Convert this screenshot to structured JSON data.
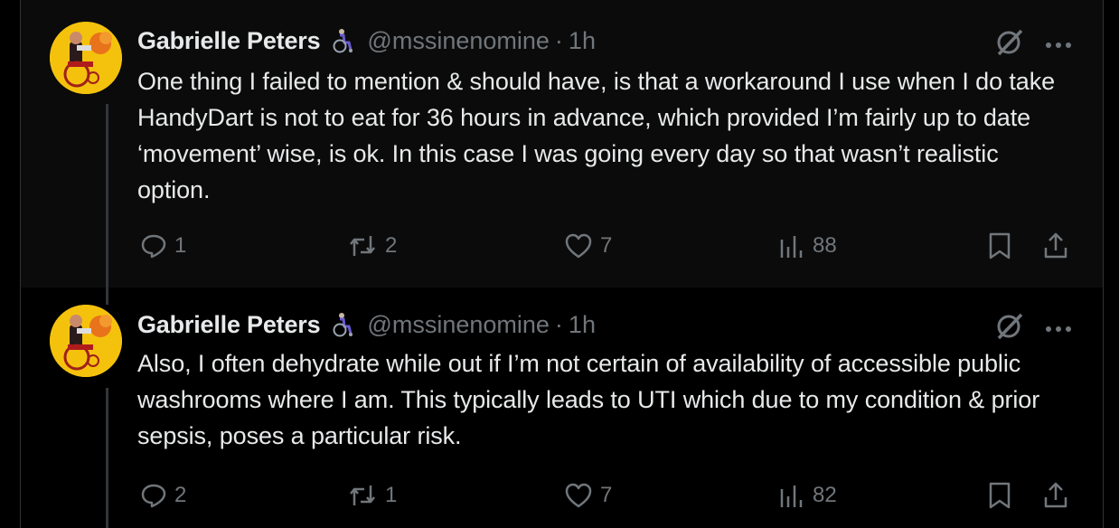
{
  "tweets": [
    {
      "author_name": "Gabrielle Peters",
      "handle": "@mssinenomine",
      "separator": "·",
      "time": "1h",
      "text": "One thing I failed to mention & should have, is that a workaround I use when I do take HandyDart is not to eat for 36 hours in advance, which provided I’m fairly up to date ‘movement’ wise, is ok. In this case I was going every day so that wasn’t realistic option.",
      "replies": "1",
      "reposts": "2",
      "likes": "7",
      "views": "88",
      "icons": [
        "avatar",
        "wheelchair-badge-icon",
        "grok-icon",
        "more-icon",
        "reply-icon",
        "repost-icon",
        "like-icon",
        "views-icon",
        "bookmark-icon",
        "share-icon"
      ]
    },
    {
      "author_name": "Gabrielle Peters",
      "handle": "@mssinenomine",
      "separator": "·",
      "time": "1h",
      "text": "Also, I often dehydrate while out if I’m not certain of availability of accessible public washrooms where I am. This typically leads to UTI which due to my condition & prior sepsis, poses a particular risk.",
      "replies": "2",
      "reposts": "1",
      "likes": "7",
      "views": "82",
      "icons": [
        "avatar",
        "wheelchair-badge-icon",
        "grok-icon",
        "more-icon",
        "reply-icon",
        "repost-icon",
        "like-icon",
        "views-icon",
        "bookmark-icon",
        "share-icon"
      ]
    }
  ],
  "colors": {
    "background": "#000000",
    "text": "#e7e9ea",
    "muted": "#71767b",
    "avatar_bg": "#f4c20d",
    "border": "#2f3336"
  }
}
